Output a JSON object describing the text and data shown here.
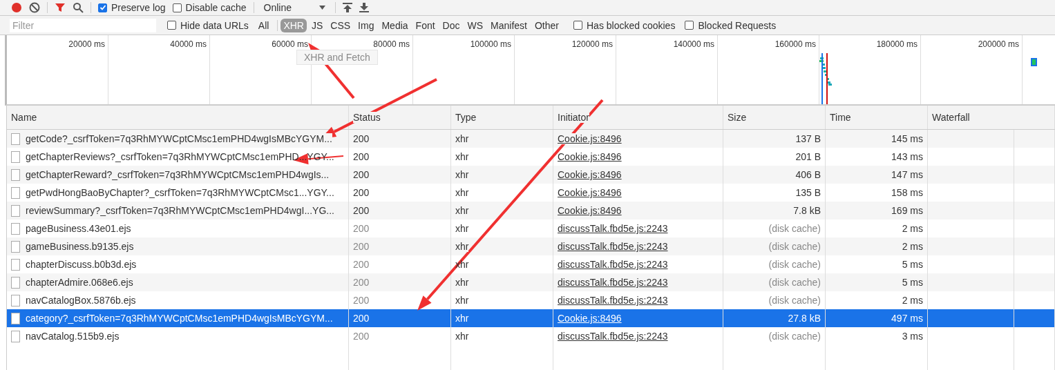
{
  "toolbar": {
    "preserve_log": {
      "label": "Preserve log",
      "checked": true
    },
    "disable_cache": {
      "label": "Disable cache",
      "checked": false
    },
    "throttling": "Online",
    "filter_active": true
  },
  "filter_bar": {
    "placeholder": "Filter",
    "hide_data_urls": {
      "label": "Hide data URLs",
      "checked": false
    },
    "types": [
      {
        "label": "All",
        "selected": false
      },
      {
        "label": "XHR",
        "selected": true
      },
      {
        "label": "JS",
        "selected": false
      },
      {
        "label": "CSS",
        "selected": false
      },
      {
        "label": "Img",
        "selected": false
      },
      {
        "label": "Media",
        "selected": false
      },
      {
        "label": "Font",
        "selected": false
      },
      {
        "label": "Doc",
        "selected": false
      },
      {
        "label": "WS",
        "selected": false
      },
      {
        "label": "Manifest",
        "selected": false
      },
      {
        "label": "Other",
        "selected": false
      }
    ],
    "toggles": [
      {
        "label": "Has blocked cookies",
        "checked": false
      },
      {
        "label": "Blocked Requests",
        "checked": false
      }
    ],
    "tooltip": "XHR and Fetch"
  },
  "overview": {
    "ticks": [
      "20000 ms",
      "40000 ms",
      "60000 ms",
      "80000 ms",
      "100000 ms",
      "120000 ms",
      "140000 ms",
      "160000 ms",
      "180000 ms",
      "200000 ms"
    ]
  },
  "table": {
    "columns": [
      "Name",
      "Status",
      "Type",
      "Initiator",
      "Size",
      "Time",
      "Waterfall"
    ],
    "rows": [
      {
        "name": "getCode?_csrfToken=7q3RhMYWCptCMsc1emPHD4wgIsMBcYGYM...",
        "status": "200",
        "type": "xhr",
        "initiator": "Cookie.js:8496",
        "size": "137 B",
        "time": "145 ms",
        "cached": false,
        "selected": false
      },
      {
        "name": "getChapterReviews?_csrfToken=7q3RhMYWCptCMsc1emPHD...YGY...",
        "status": "200",
        "type": "xhr",
        "initiator": "Cookie.js:8496",
        "size": "201 B",
        "time": "143 ms",
        "cached": false,
        "selected": false
      },
      {
        "name": "getChapterReward?_csrfToken=7q3RhMYWCptCMsc1emPHD4wgIs...",
        "status": "200",
        "type": "xhr",
        "initiator": "Cookie.js:8496",
        "size": "406 B",
        "time": "147 ms",
        "cached": false,
        "selected": false
      },
      {
        "name": "getPwdHongBaoByChapter?_csrfToken=7q3RhMYWCptCMsc1...YGY...",
        "status": "200",
        "type": "xhr",
        "initiator": "Cookie.js:8496",
        "size": "135 B",
        "time": "158 ms",
        "cached": false,
        "selected": false
      },
      {
        "name": "reviewSummary?_csrfToken=7q3RhMYWCptCMsc1emPHD4wgI...YG...",
        "status": "200",
        "type": "xhr",
        "initiator": "Cookie.js:8496",
        "size": "7.8 kB",
        "time": "169 ms",
        "cached": false,
        "selected": false
      },
      {
        "name": "pageBusiness.43e01.ejs",
        "status": "200",
        "type": "xhr",
        "initiator": "discussTalk.fbd5e.js:2243",
        "size": "(disk cache)",
        "time": "2 ms",
        "cached": true,
        "selected": false
      },
      {
        "name": "gameBusiness.b9135.ejs",
        "status": "200",
        "type": "xhr",
        "initiator": "discussTalk.fbd5e.js:2243",
        "size": "(disk cache)",
        "time": "2 ms",
        "cached": true,
        "selected": false
      },
      {
        "name": "chapterDiscuss.b0b3d.ejs",
        "status": "200",
        "type": "xhr",
        "initiator": "discussTalk.fbd5e.js:2243",
        "size": "(disk cache)",
        "time": "5 ms",
        "cached": true,
        "selected": false
      },
      {
        "name": "chapterAdmire.068e6.ejs",
        "status": "200",
        "type": "xhr",
        "initiator": "discussTalk.fbd5e.js:2243",
        "size": "(disk cache)",
        "time": "5 ms",
        "cached": true,
        "selected": false
      },
      {
        "name": "navCatalogBox.5876b.ejs",
        "status": "200",
        "type": "xhr",
        "initiator": "discussTalk.fbd5e.js:2243",
        "size": "(disk cache)",
        "time": "2 ms",
        "cached": true,
        "selected": false
      },
      {
        "name": "category?_csrfToken=7q3RhMYWCptCMsc1emPHD4wgIsMBcYGYM...",
        "status": "200",
        "type": "xhr",
        "initiator": "Cookie.js:8496",
        "size": "27.8 kB",
        "time": "497 ms",
        "cached": false,
        "selected": true
      },
      {
        "name": "navCatalog.515b9.ejs",
        "status": "200",
        "type": "xhr",
        "initiator": "discussTalk.fbd5e.js:2243",
        "size": "(disk cache)",
        "time": "3 ms",
        "cached": true,
        "selected": false
      }
    ]
  }
}
